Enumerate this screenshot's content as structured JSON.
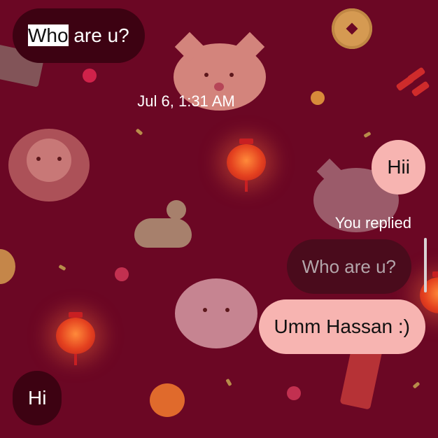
{
  "theme": {
    "background": "#6b0724",
    "incoming_bubble": "#3d0212",
    "outgoing_bubble": "#f7b4b1",
    "quoted_bubble": "#4a0b1c",
    "selection_highlight": "#ffffff"
  },
  "messages": {
    "top_incoming": {
      "selected_text": "Who",
      "rest_text": " are u?"
    },
    "timestamp": "Jul 6, 1:31 AM",
    "outgoing_1": {
      "text": "Hii"
    },
    "reply_label": "You replied",
    "quoted": {
      "text": "Who are u?"
    },
    "outgoing_2": {
      "text": "Umm Hassan :)"
    },
    "incoming_last": {
      "text": "Hi"
    }
  },
  "decorations": [
    "cat-face-icon",
    "bear-face-icon",
    "lantern-icon",
    "coin-icon",
    "duck-icon",
    "red-envelope-icon",
    "firecracker-icon",
    "orange-icon",
    "banknote-icon"
  ]
}
